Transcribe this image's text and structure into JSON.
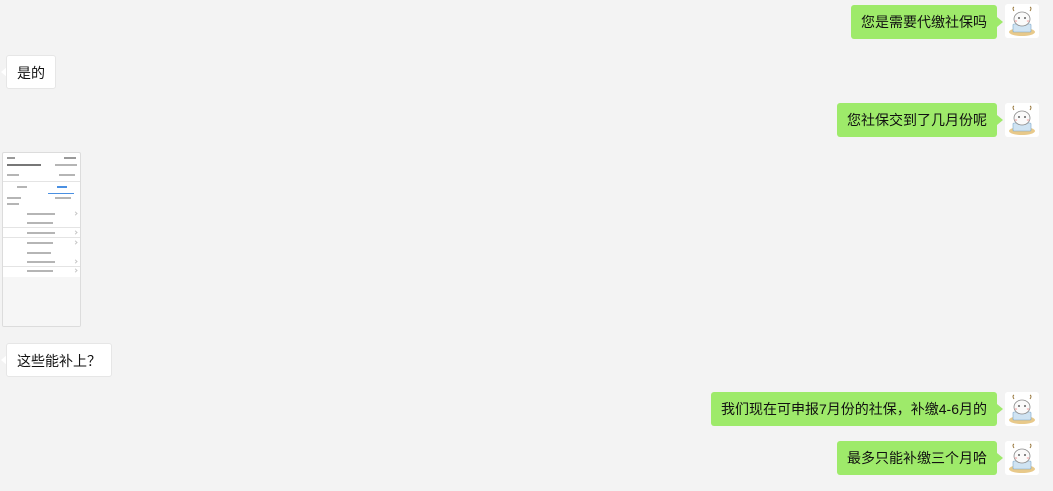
{
  "messages": [
    {
      "side": "right",
      "text": "您是需要代缴社保吗",
      "avatar": "sheep-avatar-icon"
    },
    {
      "side": "left",
      "text": "是的"
    },
    {
      "side": "right",
      "text": "您社保交到了几月份呢",
      "avatar": "sheep-avatar-icon"
    },
    {
      "side": "left",
      "type": "image",
      "alt": "screenshot-thumbnail"
    },
    {
      "side": "left",
      "text": "这些能补上？"
    },
    {
      "side": "right",
      "text": "我们现在可申报7月份的社保，补缴4-6月的",
      "avatar": "sheep-avatar-icon"
    },
    {
      "side": "right",
      "text": "最多只能补缴三个月哈",
      "avatar": "sheep-avatar-icon"
    }
  ],
  "colors": {
    "background": "#f3f3f3",
    "outgoing_bubble": "#9eea6a",
    "incoming_bubble": "#ffffff"
  }
}
